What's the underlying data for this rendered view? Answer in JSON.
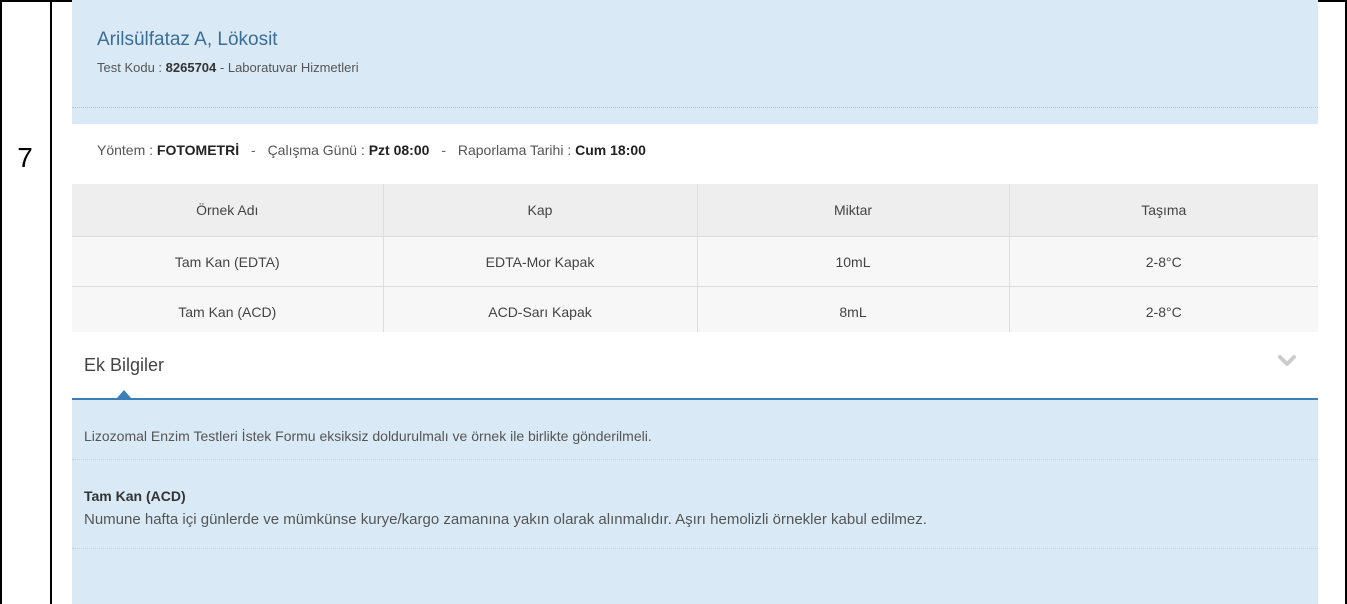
{
  "row_number": "7",
  "test": {
    "title": "Arilsülfataz A, Lökosit",
    "code_label": "Test Kodu : ",
    "code": "8265704",
    "code_suffix": " - Laboratuvar Hizmetleri"
  },
  "method": {
    "method_label": "Yöntem : ",
    "method_value": "FOTOMETRİ",
    "sep1": "-",
    "workday_label": "Çalışma Günü : ",
    "workday_value": "Pzt 08:00",
    "sep2": "-",
    "report_label": "Raporlama Tarihi : ",
    "report_value": "Cum 18:00"
  },
  "samples": {
    "headers": [
      "Örnek Adı",
      "Kap",
      "Miktar",
      "Taşıma"
    ],
    "rows": [
      [
        "Tam Kan (EDTA)",
        "EDTA-Mor Kapak",
        "10mL",
        "2-8°C"
      ],
      [
        "Tam Kan (ACD)",
        "ACD-Sarı Kapak",
        "8mL",
        "2-8°C"
      ]
    ]
  },
  "extra": {
    "title": "Ek Bilgiler",
    "expand_icon": "chevron-down-icon",
    "general_note": "Lizozomal Enzim Testleri İstek Formu eksiksiz doldurulmalı ve örnek ile birlikte gönderilmeli.",
    "sample_note_title": "Tam Kan (ACD)",
    "sample_note_text": "Numune hafta içi günlerde ve mümkünse kurye/kargo zamanına yakın olarak alınmalıdır. Aşırı hemolizli örnekler kabul edilmez."
  },
  "colors": {
    "card_bg": "#d9eaf6",
    "title": "#3a6e96",
    "accent": "#3a7fb8"
  }
}
